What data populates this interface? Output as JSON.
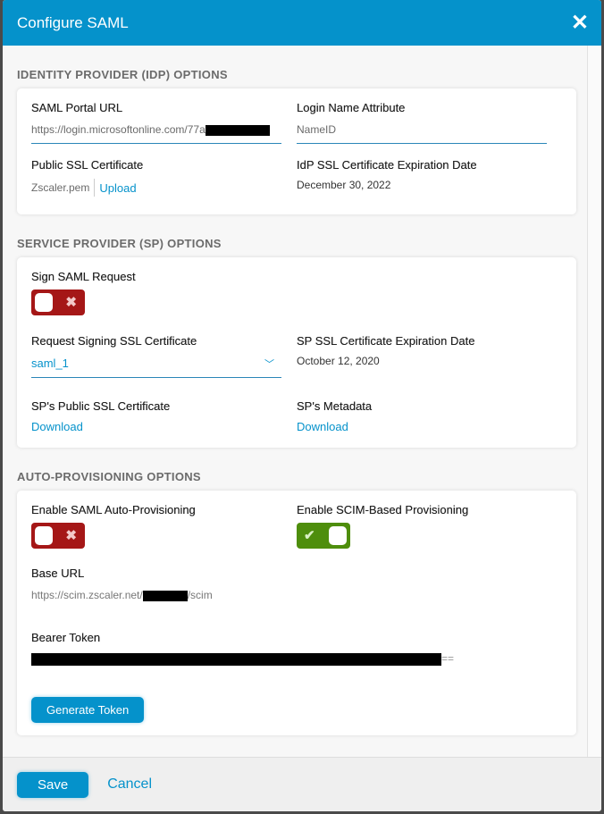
{
  "dialog": {
    "title": "Configure SAML",
    "close_icon": "close-icon"
  },
  "idp": {
    "section_title": "IDENTITY PROVIDER (IDP) OPTIONS",
    "portal_url_label": "SAML Portal URL",
    "portal_url_value": "https://login.microsoftonline.com/77a",
    "login_name_label": "Login Name Attribute",
    "login_name_value": "NameID",
    "cert_label": "Public SSL Certificate",
    "cert_file": "Zscaler.pem",
    "upload_label": "Upload",
    "expiry_label": "IdP SSL Certificate Expiration Date",
    "expiry_value": "December 30, 2022"
  },
  "sp": {
    "section_title": "SERVICE PROVIDER (SP) OPTIONS",
    "sign_label": "Sign SAML Request",
    "sign_enabled": false,
    "req_cert_label": "Request Signing SSL Certificate",
    "req_cert_value": "saml_1",
    "sp_expiry_label": "SP SSL Certificate Expiration Date",
    "sp_expiry_value": "October 12, 2020",
    "public_cert_label": "SP's Public SSL Certificate",
    "public_cert_link": "Download",
    "metadata_label": "SP's Metadata",
    "metadata_link": "Download"
  },
  "auto": {
    "section_title": "AUTO-PROVISIONING OPTIONS",
    "saml_auto_label": "Enable SAML Auto-Provisioning",
    "saml_auto_enabled": false,
    "scim_label": "Enable SCIM-Based Provisioning",
    "scim_enabled": true,
    "base_url_label": "Base URL",
    "base_url_prefix": "https://scim.zscaler.net/",
    "base_url_suffix": "/scim",
    "token_label": "Bearer Token",
    "token_suffix": "==",
    "generate_label": "Generate Token"
  },
  "footer": {
    "save": "Save",
    "cancel": "Cancel"
  },
  "colors": {
    "accent": "#0592cb",
    "off": "#a51717",
    "on": "#4e8e0c"
  }
}
